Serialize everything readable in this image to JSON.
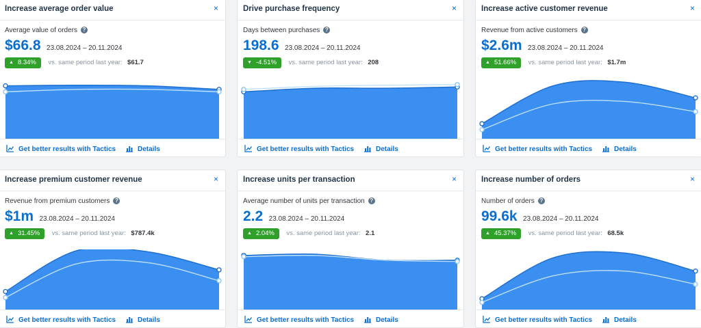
{
  "footer": {
    "tactics_label": "Get better results with Tactics",
    "details_label": "Details",
    "comparison_prefix": "vs. same period last year:",
    "close_symbol": "×",
    "help_symbol": "?"
  },
  "colors": {
    "accent": "#0a6ed1",
    "area_fill": "#3a8ff0",
    "area_stroke": "#1f6fd0",
    "prior_line": "#bfe0fb",
    "badge_green": "#2fa12a"
  },
  "cards": [
    {
      "title": "Increase average order value",
      "metric_label": "Average value of orders",
      "value": "$66.8",
      "date_range": "23.08.2024 – 20.11.2024",
      "change": "8.34%",
      "change_direction": "up",
      "prior_value": "$61.7",
      "trend_current": [
        0.88,
        0.89,
        0.88,
        0.82
      ],
      "trend_prior": [
        0.78,
        0.82,
        0.82,
        0.78
      ]
    },
    {
      "title": "Drive purchase frequency",
      "metric_label": "Days between purchases",
      "value": "198.6",
      "date_range": "23.08.2024 – 20.11.2024",
      "change": "-4.51%",
      "change_direction": "down",
      "prior_value": "208",
      "trend_current": [
        0.78,
        0.84,
        0.84,
        0.86
      ],
      "trend_prior": [
        0.82,
        0.87,
        0.89,
        0.9
      ]
    },
    {
      "title": "Increase active customer revenue",
      "metric_label": "Revenue from active customers",
      "value": "$2.6m",
      "date_range": "23.08.2024 – 20.11.2024",
      "change": "51.66%",
      "change_direction": "up",
      "prior_value": "$1.7m",
      "trend_current": [
        0.25,
        0.88,
        0.94,
        0.68
      ],
      "trend_prior": [
        0.15,
        0.58,
        0.62,
        0.45
      ]
    },
    {
      "title": "Increase premium customer revenue",
      "metric_label": "Revenue from premium customers",
      "value": "$1m",
      "date_range": "23.08.2024 – 20.11.2024",
      "change": "31.45%",
      "change_direction": "up",
      "prior_value": "$787.4k",
      "trend_current": [
        0.3,
        0.98,
        0.96,
        0.66
      ],
      "trend_prior": [
        0.2,
        0.76,
        0.78,
        0.48
      ]
    },
    {
      "title": "Increase units per transaction",
      "metric_label": "Average number of units per transaction",
      "value": "2.2",
      "date_range": "23.08.2024 – 20.11.2024",
      "change": "2.04%",
      "change_direction": "up",
      "prior_value": "2.1",
      "trend_current": [
        0.9,
        0.92,
        0.82,
        0.82
      ],
      "trend_prior": [
        0.88,
        0.9,
        0.82,
        0.8
      ]
    },
    {
      "title": "Increase number of orders",
      "metric_label": "Number of orders",
      "value": "99.6k",
      "date_range": "23.08.2024 – 20.11.2024",
      "change": "45.37%",
      "change_direction": "up",
      "prior_value": "68.5k",
      "trend_current": [
        0.18,
        0.86,
        0.94,
        0.64
      ],
      "trend_prior": [
        0.12,
        0.56,
        0.64,
        0.42
      ]
    }
  ]
}
